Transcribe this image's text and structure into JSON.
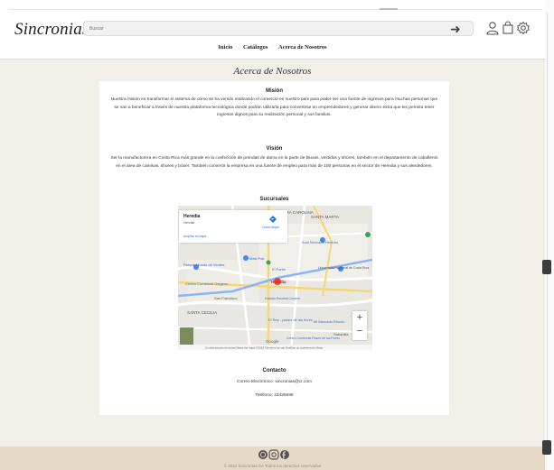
{
  "header": {
    "logo": "Sincronias",
    "search_placeholder": "Buscar",
    "icons": [
      "arrow-right-icon",
      "user-icon",
      "bag-icon",
      "gear-icon"
    ]
  },
  "nav": {
    "items": [
      "Inicio",
      "Catálogos",
      "Acerca de Nosotros"
    ]
  },
  "page_title": "Acerca de Nosotros",
  "mision": {
    "title": "Misión",
    "text": "Nuestra misión es transformar el sistema de cómo se ha venido realizando el comercio en nuestro país para poder ser una fuente de ingresos para muchas personas que se van a beneficiar a través de nuestra plataforma tecnológica donde podrán utilizarla para convertirse en emprendedores y generar dinero extra que les permita tener ingresos dignos para su realización personal y sus familias."
  },
  "vision": {
    "title": "Visión",
    "text": "Ser la manufacturera en Costa Rica más grande en la confección de prendas de dama en la parte de blusas, vestidos y shores, también en el departamento de caballeros en el área de camisas, shores y bóxer. También convertir la empresa en una fuente de empleo para más de 100 personas en el sector de Heredia y sus alrededores."
  },
  "sucursales": {
    "title": "Sucursales",
    "map": {
      "place_name": "Heredia",
      "place_sub": "Heredia",
      "directions": "Cómo llegar",
      "larger_map": "Ampliar el mapa",
      "labels": [
        "ANDRA CAROLINA",
        "SANTA MARTA",
        "Aulo Mercado Heredia",
        "Maxi Palí",
        "El Fortín",
        "Universidad Nacional de Costa Rica",
        "Centro Comercial Oxígeno",
        "Heredia",
        "Parque Mundo de Verdes",
        "San Francisco",
        "Estadio Rosabal Cordero",
        "SANTA CECILIA",
        "El Rey - paseo de las flores",
        "Mi Mercado Rincón",
        "Sabanilla",
        "Centro Comercial Paseo de las Flores",
        "Google"
      ],
      "attribution": "Combinaciones de teclas   Datos del mapa ©2023   Términos de uso   Notificar un problema de Maps"
    }
  },
  "contacto": {
    "title": "Contacto",
    "email": "Correo Electrónico: sincronias@cr.com",
    "phone": "Teléfono: 22425698"
  },
  "footer": {
    "icons": [
      "whatsapp-icon",
      "instagram-icon",
      "facebook-icon"
    ],
    "copyright": "© 2023 Sincronías SA Todos los derechos reservados"
  },
  "colors": {
    "beige": "#f2efe9",
    "footer": "#e6d9c6",
    "link": "#1a73e8"
  }
}
